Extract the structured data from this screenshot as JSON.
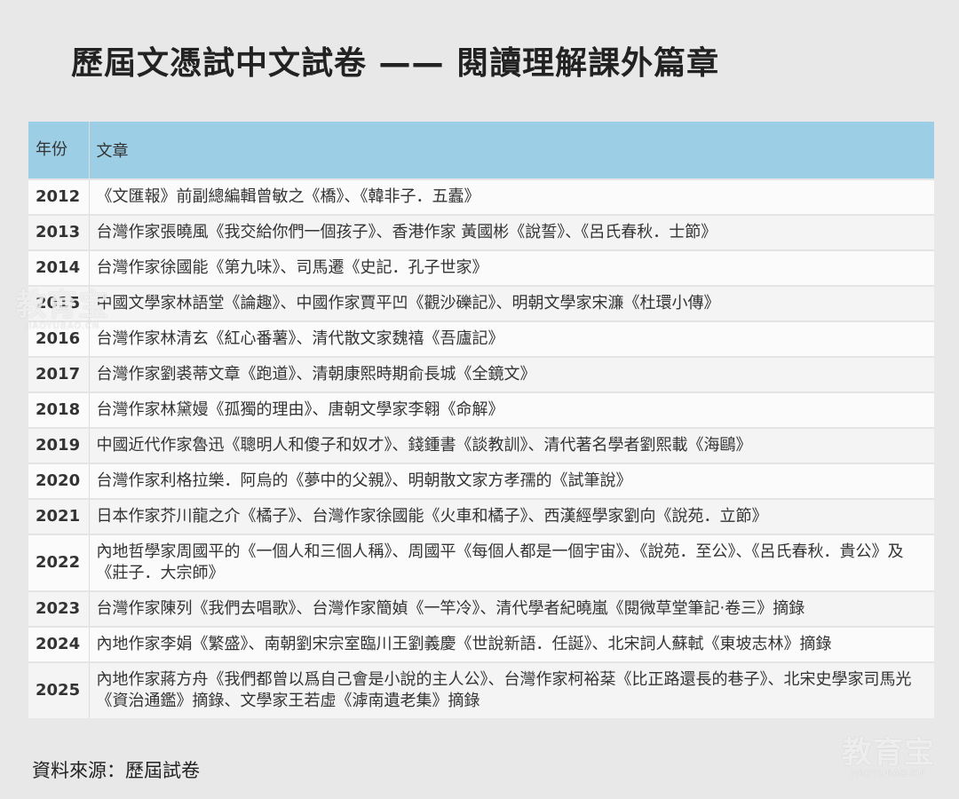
{
  "title": "歷屆文憑試中文試卷 —— 閱讀理解課外篇章",
  "table": {
    "header": {
      "year": "年份",
      "text": "文章"
    },
    "rows": [
      {
        "year": "2012",
        "text": "《文匯報》前副總編輯曾敏之《橋》、《韓非子．五蠹》"
      },
      {
        "year": "2013",
        "text": "台灣作家張曉風《我交給你們一個孩子》、香港作家 黃國彬《說誓》、《呂氏春秋．士節》"
      },
      {
        "year": "2014",
        "text": "台灣作家徐國能《第九味》、司馬遷《史記．孔子世家》"
      },
      {
        "year": "2015",
        "text": "中國文學家林語堂《論趣》、中國作家賈平凹《觀沙礫記》、明朝文學家宋濂《杜環小傳》"
      },
      {
        "year": "2016",
        "text": "台灣作家林清玄《紅心番薯》、清代散文家魏禧《吾廬記》"
      },
      {
        "year": "2017",
        "text": "台灣作家劉裘蒂文章《跑道》、清朝康熙時期俞長城《全鏡文》"
      },
      {
        "year": "2018",
        "text": "台灣作家林黛嫚《孤獨的理由》、唐朝文學家李翱《命解》"
      },
      {
        "year": "2019",
        "text": "中國近代作家魯迅《聰明人和傻子和奴才》、錢鍾書《談教訓》、清代著名學者劉熙載《海鷗》"
      },
      {
        "year": "2020",
        "text": "台灣作家利格拉樂．阿烏的《夢中的父親》、明朝散文家方孝孺的《試筆說》"
      },
      {
        "year": "2021",
        "text": "日本作家芥川龍之介《橘子》、台灣作家徐國能《火車和橘子》、西漢經學家劉向《說苑．立節》"
      },
      {
        "year": "2022",
        "text": "內地哲學家周國平的《一個人和三個人稱》、周國平《每個人都是一個宇宙》、《說苑．至公》、《呂氏春秋．貴公》及《莊子．大宗師》"
      },
      {
        "year": "2023",
        "text": "台灣作家陳列《我們去唱歌》、台灣作家簡媜《一竿冷》、清代學者紀曉嵐《閱微草堂筆記‧卷三》摘錄"
      },
      {
        "year": "2024",
        "text": "內地作家李娟《繁盛》、南朝劉宋宗室臨川王劉義慶《世說新語．任誕》、北宋詞人蘇軾《東坡志林》摘錄"
      },
      {
        "year": "2025",
        "text": "內地作家蔣方舟《我們都曾以爲自己會是小說的主人公》、台灣作家柯裕棻《比正路還長的巷子》、北宋史學家司馬光《資治通鑑》摘錄、文學家王若虛《滹南遺老集》摘錄"
      }
    ]
  },
  "source": "資料來源：歷屆試卷",
  "watermark": {
    "main": "教育宝",
    "sub": "JIAOYUBAO.CN"
  }
}
